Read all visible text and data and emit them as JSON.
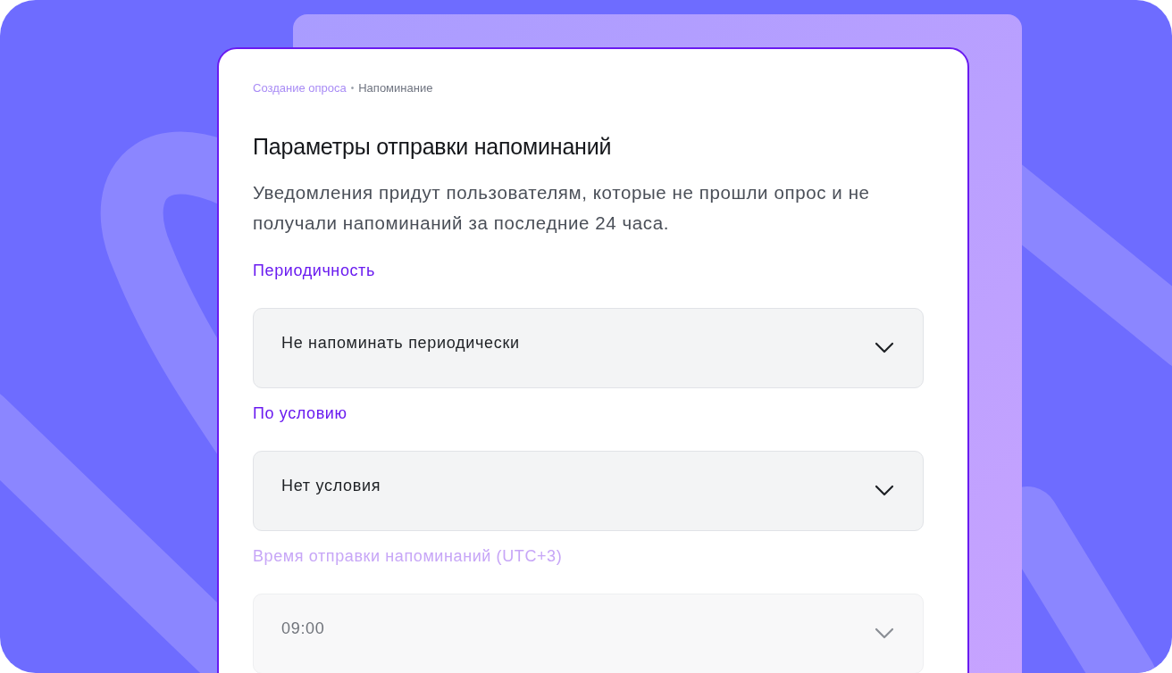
{
  "breadcrumb": [
    {
      "label": "Создание опроса",
      "selected": false
    },
    {
      "label": "Напоминание",
      "selected": true
    }
  ],
  "breadcrumb_separator": "•",
  "title": "Параметры отправки напоминаний",
  "description": "Уведомления придут пользователям, которые не прошли опрос и не получали напоминаний за последние 24 часа.",
  "fields": [
    {
      "label": "Периодичность",
      "value": "Не напоминать периодически",
      "disabled": false
    },
    {
      "label": "По условию",
      "value": "Нет условия",
      "disabled": false
    },
    {
      "label": "Время отправки напоминаний (UTC+3)",
      "value": "09:00",
      "disabled": true
    }
  ]
}
